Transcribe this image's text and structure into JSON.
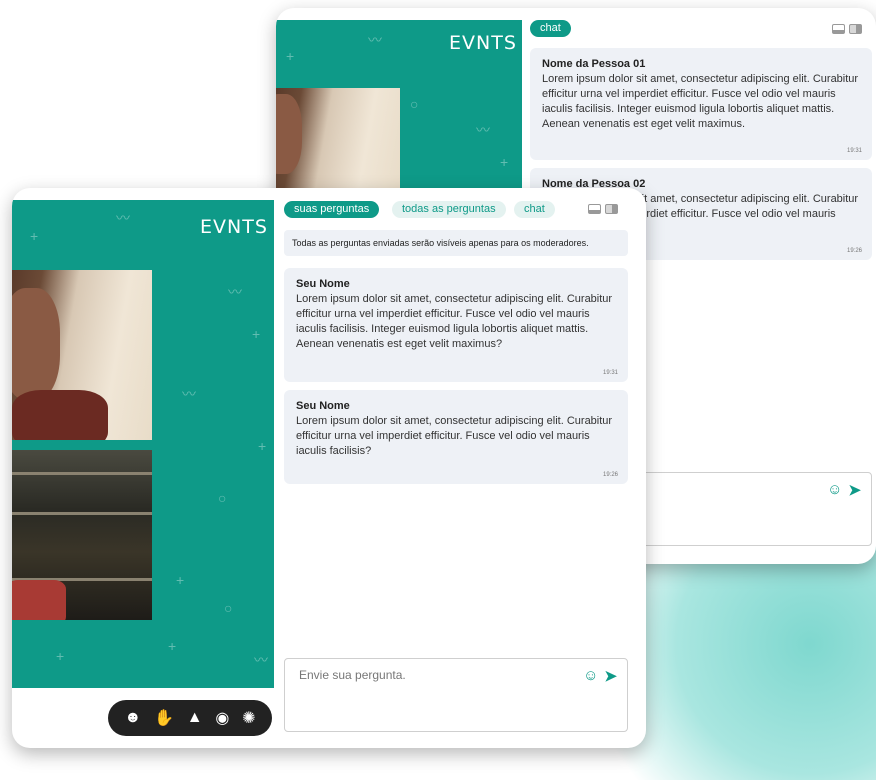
{
  "brand": {
    "logo": "EVNTS",
    "accent": "#0e9a88"
  },
  "back_window": {
    "tab_chat": "chat",
    "messages": [
      {
        "name": "Nome da Pessoa 01",
        "text": "Lorem ipsum dolor sit amet, consectetur adipiscing elit. Curabitur efficitur urna vel imperdiet efficitur. Fusce vel odio vel mauris iaculis facilisis. Integer euismod ligula lobortis aliquet mattis. Aenean venenatis est eget velit maximus.",
        "time": "19:31"
      },
      {
        "name": "Nome da Pessoa 02",
        "text": "Lorem ipsum dolor sit amet, consectetur adipiscing elit. Curabitur efficitur urna vel imperdiet efficitur. Fusce vel odio vel mauris iaculis facilisis.",
        "time": "19:26"
      }
    ]
  },
  "front_window": {
    "tabs": [
      {
        "label": "suas perguntas"
      },
      {
        "label": "todas as perguntas"
      },
      {
        "label": "chat"
      }
    ],
    "notice": "Todas as perguntas enviadas serão visíveis apenas para os moderadores.",
    "messages": [
      {
        "name": "Seu Nome",
        "text": "Lorem ipsum dolor sit amet, consectetur adipiscing elit. Curabitur efficitur urna vel imperdiet efficitur. Fusce vel odio vel mauris iaculis facilisis. Integer euismod ligula lobortis aliquet mattis. Aenean venenatis est eget velit maximus?",
        "time": "19:31"
      },
      {
        "name": "Seu Nome",
        "text": "Lorem ipsum dolor sit amet, consectetur adipiscing elit. Curabitur efficitur urna vel imperdiet efficitur. Fusce vel odio vel mauris iaculis facilisis?",
        "time": "19:26"
      }
    ],
    "input_placeholder": "Envie sua pergunta.",
    "reactions": [
      "smile-icon",
      "clap-icon",
      "thumbs-up-icon",
      "surprised-icon",
      "party-icon"
    ]
  },
  "icons": {
    "emoji": "emoji-icon",
    "send": "send-icon",
    "layout_bottom": "layout-bottom-icon",
    "layout_side": "layout-side-icon"
  }
}
